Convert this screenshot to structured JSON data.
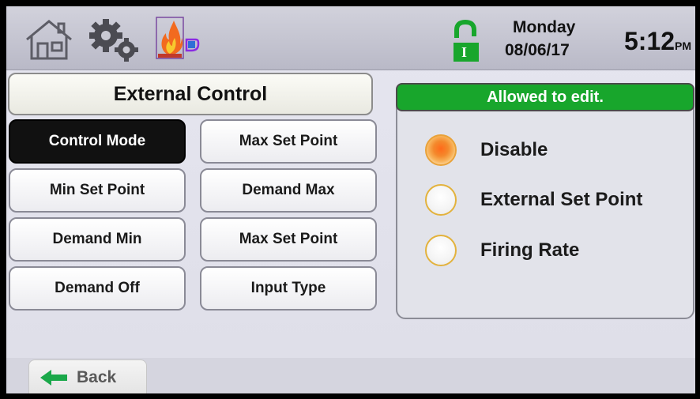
{
  "header": {
    "day": "Monday",
    "date": "08/06/17",
    "time": "5:12",
    "ampm": "PM",
    "lock_letter": "I",
    "icons": [
      "home-icon",
      "gear-icon",
      "flame-icon",
      "lock-icon"
    ]
  },
  "page_title": "External Control",
  "menu": {
    "buttons": [
      {
        "label": "Control Mode",
        "active": true
      },
      {
        "label": "Max Set Point",
        "active": false
      },
      {
        "label": "Min Set Point",
        "active": false
      },
      {
        "label": "Demand Max",
        "active": false
      },
      {
        "label": "Demand Min",
        "active": false
      },
      {
        "label": "Max Set Point",
        "active": false
      },
      {
        "label": "Demand Off",
        "active": false
      },
      {
        "label": "Input Type",
        "active": false
      }
    ]
  },
  "edit_status": "Allowed to edit.",
  "options": [
    {
      "label": "Disable",
      "selected": true
    },
    {
      "label": "External Set Point",
      "selected": false
    },
    {
      "label": "Firing Rate",
      "selected": false
    }
  ],
  "back_label": "Back",
  "colors": {
    "status_green": "#18a62c",
    "radio_selected": "#f4892c",
    "back_arrow": "#1aa84a"
  }
}
